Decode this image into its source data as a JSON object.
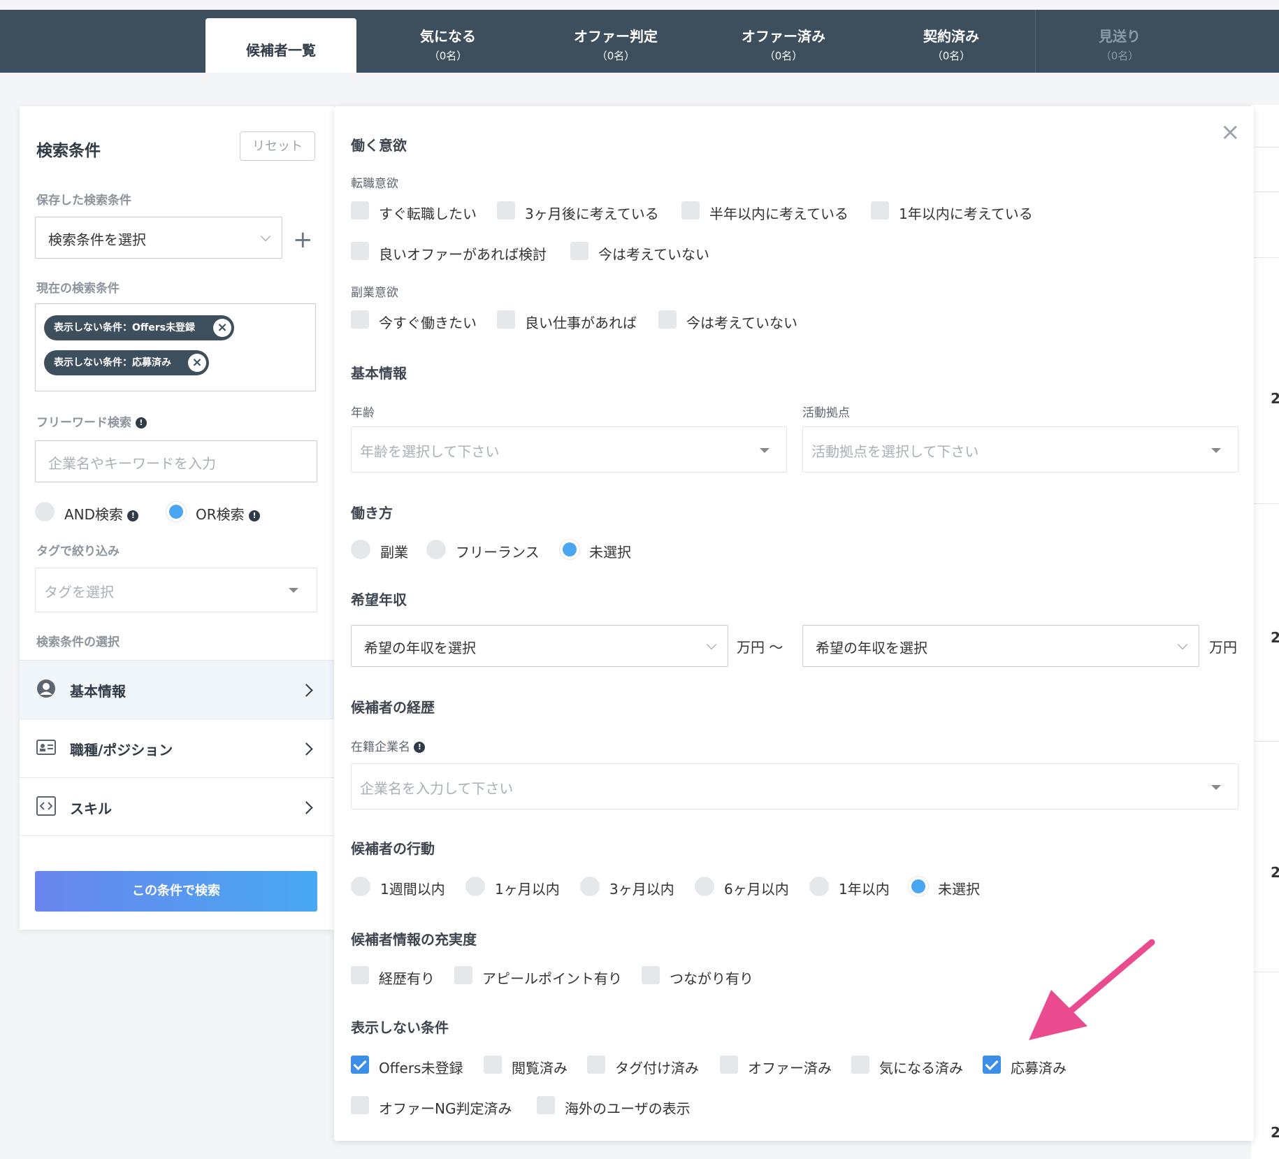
{
  "tabs": [
    {
      "label": "候補者一覧",
      "count": ""
    },
    {
      "label": "気になる",
      "count": "（0名）"
    },
    {
      "label": "オファー判定",
      "count": "（0名）"
    },
    {
      "label": "オファー済み",
      "count": "（0名）"
    },
    {
      "label": "契約済み",
      "count": "（0名）"
    },
    {
      "label": "見送り",
      "count": "（0名）"
    }
  ],
  "behind": {
    "counts": [
      "2",
      "2",
      "2",
      "2"
    ]
  },
  "left": {
    "title": "検索条件",
    "reset": "リセット",
    "saved_label": "保存した検索条件",
    "saved_select": "検索条件を選択",
    "current_label": "現在の検索条件",
    "chips": [
      "表示しない条件：Offers未登録",
      "表示しない条件：応募済み"
    ],
    "freeword_label": "フリーワード検索",
    "freeword_placeholder": "企業名やキーワードを入力",
    "and_label": "AND検索",
    "or_label": "OR検索",
    "tag_label": "タグで絞り込み",
    "tag_placeholder": "タグを選択",
    "criteria_label": "検索条件の選択",
    "menu": [
      "基本情報",
      "職種/ポジション",
      "スキル"
    ],
    "search_button": "この条件で検索"
  },
  "panel": {
    "motivation_title": "働く意欲",
    "job_change_label": "転職意欲",
    "job_change_options": [
      "すぐ転職したい",
      "3ヶ月後に考えている",
      "半年以内に考えている",
      "1年以内に考えている",
      "良いオファーがあれば検討",
      "今は考えていない"
    ],
    "side_job_label": "副業意欲",
    "side_job_options": [
      "今すぐ働きたい",
      "良い仕事があれば",
      "今は考えていない"
    ],
    "basic_title": "基本情報",
    "age_label": "年齢",
    "age_placeholder": "年齢を選択して下さい",
    "location_label": "活動拠点",
    "location_placeholder": "活動拠点を選択して下さい",
    "work_style_title": "働き方",
    "work_style_options": [
      "副業",
      "フリーランス",
      "未選択"
    ],
    "work_style_selected": "未選択",
    "income_title": "希望年収",
    "income_select": "希望の年収を選択",
    "income_unit_mid": "万円 〜",
    "income_unit_end": "万円",
    "career_title": "候補者の経歴",
    "company_label": "在籍企業名",
    "company_placeholder": "企業名を入力して下さい",
    "activity_title": "候補者の行動",
    "activity_options": [
      "1週間以内",
      "1ヶ月以内",
      "3ヶ月以内",
      "6ヶ月以内",
      "1年以内",
      "未選択"
    ],
    "activity_selected": "未選択",
    "fullness_title": "候補者情報の充実度",
    "fullness_options": [
      "経歴有り",
      "アピールポイント有り",
      "つながり有り"
    ],
    "hide_title": "表示しない条件",
    "hide_options": [
      "Offers未登録",
      "閲覧済み",
      "タグ付け済み",
      "オファー済み",
      "気になる済み",
      "応募済み",
      "オファーNG判定済み",
      "海外のユーザの表示"
    ],
    "hide_checked": [
      "Offers未登録",
      "応募済み"
    ]
  },
  "colors": {
    "accent": "#3d8ee6",
    "radio": "#4aa6f0",
    "topbar": "#3d4e5c",
    "arrow": "#e94b8e"
  }
}
